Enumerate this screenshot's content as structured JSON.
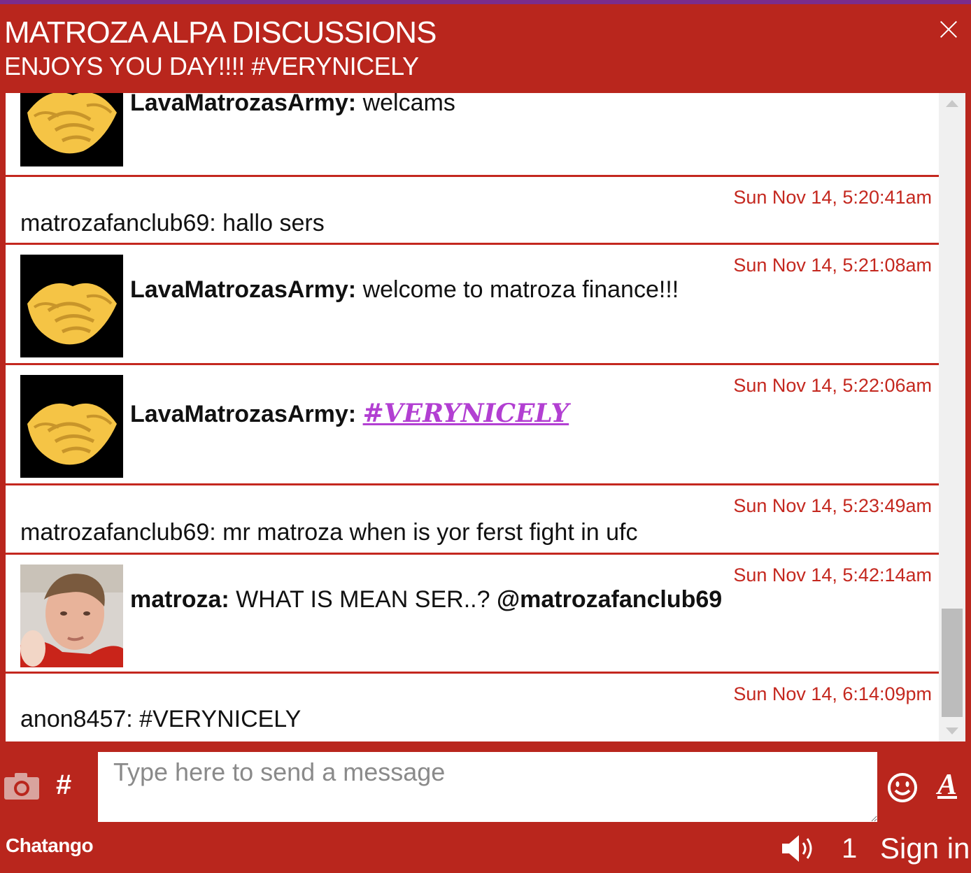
{
  "header": {
    "title": "MATROZA ALPA DISCUSSIONS",
    "subtitle": "ENJOYS YOU DAY!!!! #VERYNICELY"
  },
  "messages": [
    {
      "avatar": "handshake-emoji",
      "user": "LavaMatrozasArmy:",
      "text": " welcams",
      "timestamp": ""
    },
    {
      "avatar": "",
      "user": "matrozafanclub69:",
      "text": " hallo sers",
      "timestamp": "Sun Nov 14, 5:20:41am"
    },
    {
      "avatar": "handshake-emoji",
      "user": "LavaMatrozasArmy:",
      "text": " welcome to matroza finance!!!",
      "timestamp": "Sun Nov 14, 5:21:08am"
    },
    {
      "avatar": "handshake-emoji",
      "user": "LavaMatrozasArmy:",
      "text": "#VERYNICELY",
      "timestamp": "Sun Nov 14, 5:22:06am"
    },
    {
      "avatar": "",
      "user": "matrozafanclub69:",
      "text": " mr matroza when is yor ferst fight in ufc",
      "timestamp": "Sun Nov 14, 5:23:49am"
    },
    {
      "avatar": "user-photo",
      "user": "matroza:",
      "text": " WHAT IS MEAN SER..? ",
      "mention": "@matrozafanclub69",
      "timestamp": "Sun Nov 14, 5:42:14am"
    },
    {
      "avatar": "",
      "user": "anon8457:",
      "text": " #VERYNICELY",
      "timestamp": "Sun Nov 14, 6:14:09pm"
    }
  ],
  "composer": {
    "placeholder": "Type here to send a message",
    "hash_label": "#",
    "font_label": "A"
  },
  "footer": {
    "brand": "Chatango",
    "user_count": "1",
    "sign_in": "Sign in"
  },
  "colors": {
    "accent": "#b9261d",
    "timestamp": "#c4281f",
    "hashtag": "#b23fd2",
    "top_stripe": "#7b2c8c"
  }
}
